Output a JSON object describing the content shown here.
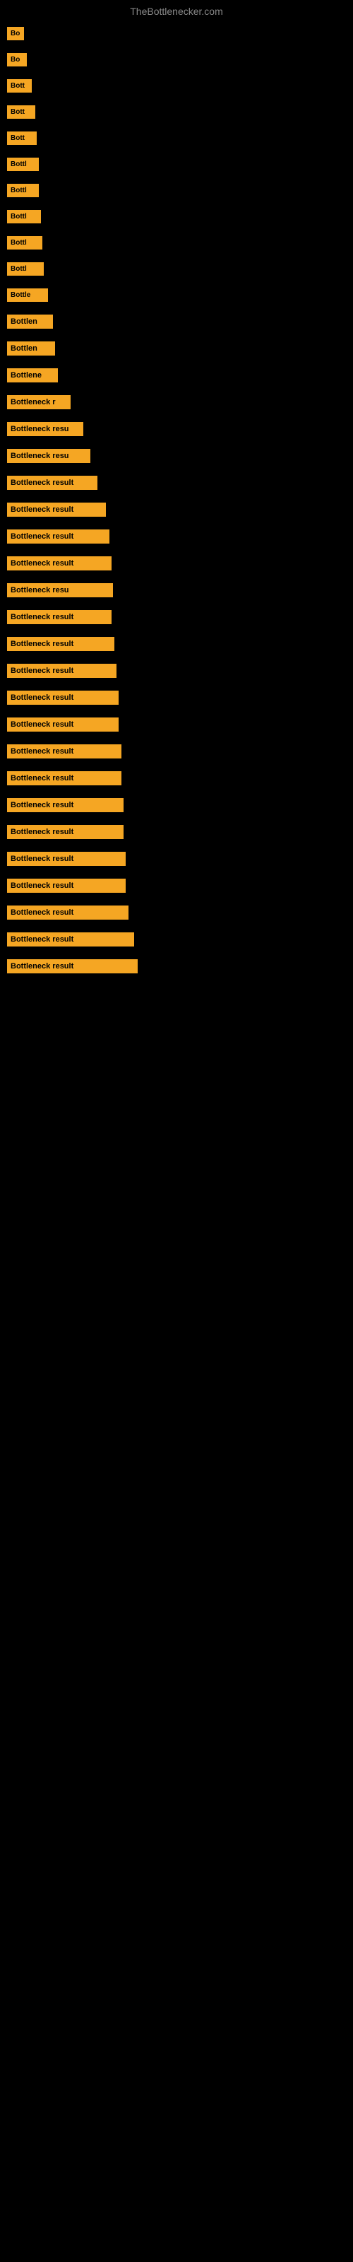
{
  "site": {
    "title": "TheBottlenecker.com"
  },
  "items": [
    {
      "id": 1,
      "label": "Bo",
      "class": "item-1"
    },
    {
      "id": 2,
      "label": "Bo",
      "class": "item-2"
    },
    {
      "id": 3,
      "label": "Bott",
      "class": "item-3"
    },
    {
      "id": 4,
      "label": "Bott",
      "class": "item-4"
    },
    {
      "id": 5,
      "label": "Bott",
      "class": "item-5"
    },
    {
      "id": 6,
      "label": "Bottl",
      "class": "item-6"
    },
    {
      "id": 7,
      "label": "Bottl",
      "class": "item-7"
    },
    {
      "id": 8,
      "label": "Bottl",
      "class": "item-8"
    },
    {
      "id": 9,
      "label": "Bottl",
      "class": "item-9"
    },
    {
      "id": 10,
      "label": "Bottl",
      "class": "item-10"
    },
    {
      "id": 11,
      "label": "Bottle",
      "class": "item-11"
    },
    {
      "id": 12,
      "label": "Bottlen",
      "class": "item-12"
    },
    {
      "id": 13,
      "label": "Bottlen",
      "class": "item-13"
    },
    {
      "id": 14,
      "label": "Bottlene",
      "class": "item-14"
    },
    {
      "id": 15,
      "label": "Bottleneck r",
      "class": "item-15"
    },
    {
      "id": 16,
      "label": "Bottleneck resu",
      "class": "item-16"
    },
    {
      "id": 17,
      "label": "Bottleneck resu",
      "class": "item-17"
    },
    {
      "id": 18,
      "label": "Bottleneck result",
      "class": "item-18"
    },
    {
      "id": 19,
      "label": "Bottleneck result",
      "class": "item-19"
    },
    {
      "id": 20,
      "label": "Bottleneck result",
      "class": "item-20"
    },
    {
      "id": 21,
      "label": "Bottleneck result",
      "class": "item-21"
    },
    {
      "id": 22,
      "label": "Bottleneck resu",
      "class": "item-22"
    },
    {
      "id": 23,
      "label": "Bottleneck result",
      "class": "item-23"
    },
    {
      "id": 24,
      "label": "Bottleneck result",
      "class": "item-24"
    },
    {
      "id": 25,
      "label": "Bottleneck result",
      "class": "item-25"
    },
    {
      "id": 26,
      "label": "Bottleneck result",
      "class": "item-26"
    },
    {
      "id": 27,
      "label": "Bottleneck result",
      "class": "item-27"
    },
    {
      "id": 28,
      "label": "Bottleneck result",
      "class": "item-28"
    },
    {
      "id": 29,
      "label": "Bottleneck result",
      "class": "item-29"
    },
    {
      "id": 30,
      "label": "Bottleneck result",
      "class": "item-30"
    },
    {
      "id": 31,
      "label": "Bottleneck result",
      "class": "item-31"
    },
    {
      "id": 32,
      "label": "Bottleneck result",
      "class": "item-32"
    },
    {
      "id": 33,
      "label": "Bottleneck result",
      "class": "item-33"
    },
    {
      "id": 34,
      "label": "Bottleneck result",
      "class": "item-34"
    },
    {
      "id": 35,
      "label": "Bottleneck result",
      "class": "item-35"
    },
    {
      "id": 36,
      "label": "Bottleneck result",
      "class": "item-36"
    }
  ]
}
